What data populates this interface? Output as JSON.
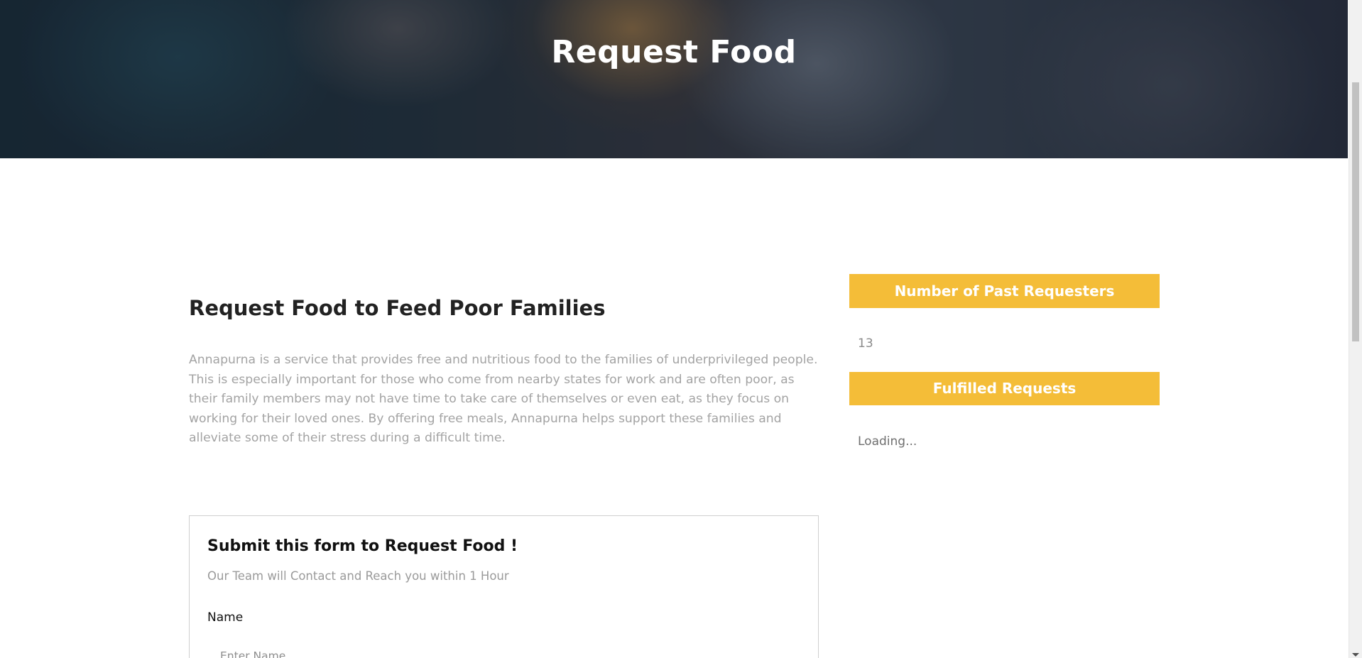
{
  "hero": {
    "title": "Request Food"
  },
  "main": {
    "heading": "Request Food to Feed Poor Families",
    "paragraph": "Annapurna is a service that provides free and nutritious food to the families of underprivileged people. This is especially important for those who come from nearby states for work and are often poor, as their family members may not have time to take care of themselves or even eat, as they focus on working for their loved ones. By offering free meals, Annapurna helps support these families and alleviate some of their stress during a difficult time."
  },
  "form": {
    "title": "Submit this form to Request Food !",
    "subtitle": "Our Team will Contact and Reach you within 1 Hour",
    "name_label": "Name",
    "name_placeholder": "Enter Name",
    "name_value": ""
  },
  "sidebar": {
    "past_requesters_title": "Number of Past Requesters",
    "past_requesters_count": "13",
    "fulfilled_title": "Fulfilled Requests",
    "fulfilled_status": "Loading..."
  },
  "colors": {
    "accent": "#f4bd38",
    "heading_text": "#222222",
    "muted_text": "#a3a3a3"
  },
  "scrollbar": {
    "icons": [
      "chevron-down-icon"
    ]
  }
}
